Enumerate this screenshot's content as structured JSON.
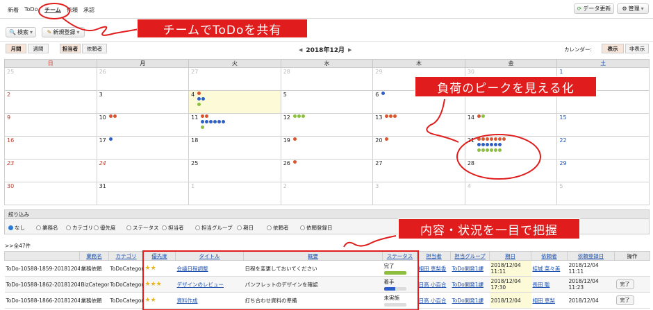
{
  "top_tabs": [
    "新着",
    "ToDo",
    "チーム",
    "依頼",
    "承認"
  ],
  "header_buttons": {
    "refresh": "データ更新",
    "admin": "管理"
  },
  "toolbar": {
    "search": "検索",
    "new": "新規登録"
  },
  "view_toggle": {
    "month": "月間",
    "week": "週間"
  },
  "person_toggle": {
    "assignee": "担当者",
    "requester": "依頼者"
  },
  "month_nav": {
    "prev": "◀",
    "label": "2018年12月",
    "next": "▶"
  },
  "calendar_toggle": {
    "label": "カレンダー:",
    "show": "表示",
    "hide": "非表示"
  },
  "weekdays": [
    "日",
    "月",
    "火",
    "水",
    "木",
    "金",
    "土"
  ],
  "colors": {
    "red": "#d9542e",
    "blue": "#2c5fc9",
    "green": "#8bbf3d",
    "callout": "#e01c1c",
    "accent_header": "#c0392b"
  },
  "weeks": [
    [
      {
        "d": "25",
        "dim": true,
        "dots": []
      },
      {
        "d": "26",
        "dim": true,
        "dots": []
      },
      {
        "d": "27",
        "dim": true,
        "dots": []
      },
      {
        "d": "28",
        "dim": true,
        "dots": []
      },
      {
        "d": "29",
        "dim": true,
        "dots": []
      },
      {
        "d": "30",
        "dim": true,
        "dots": []
      },
      {
        "d": "1",
        "dots": []
      }
    ],
    [
      {
        "d": "2",
        "dots": []
      },
      {
        "d": "3",
        "dots": []
      },
      {
        "d": "4",
        "today": true,
        "dots": [
          "red",
          "blue",
          "blue",
          "green"
        ]
      },
      {
        "d": "5",
        "dots": []
      },
      {
        "d": "6",
        "dots": [
          "blue"
        ]
      },
      {
        "d": "7",
        "dots": []
      },
      {
        "d": "8",
        "dots": []
      }
    ],
    [
      {
        "d": "9",
        "dots": []
      },
      {
        "d": "10",
        "dots": [
          "red",
          "red"
        ]
      },
      {
        "d": "11",
        "dots": [
          "red",
          "red",
          "blue",
          "blue",
          "blue",
          "blue",
          "blue",
          "blue",
          "green"
        ]
      },
      {
        "d": "12",
        "dots": [
          "green",
          "green",
          "green"
        ]
      },
      {
        "d": "13",
        "dots": [
          "red",
          "red",
          "red"
        ]
      },
      {
        "d": "14",
        "dots": [
          "red",
          "green"
        ]
      },
      {
        "d": "15",
        "dots": []
      }
    ],
    [
      {
        "d": "16",
        "dots": []
      },
      {
        "d": "17",
        "dots": [
          "blue"
        ]
      },
      {
        "d": "18",
        "dots": []
      },
      {
        "d": "19",
        "dots": [
          "red"
        ]
      },
      {
        "d": "20",
        "dots": [
          "red"
        ]
      },
      {
        "d": "21",
        "dots": [
          "red",
          "red",
          "red",
          "red",
          "red",
          "red",
          "red",
          "blue",
          "blue",
          "blue",
          "blue",
          "blue",
          "blue",
          "green",
          "green",
          "green",
          "green",
          "green",
          "green"
        ]
      },
      {
        "d": "22",
        "dots": []
      }
    ],
    [
      {
        "d": "23",
        "holiday": true,
        "dots": []
      },
      {
        "d": "24",
        "holiday": true,
        "dots": []
      },
      {
        "d": "25",
        "dots": []
      },
      {
        "d": "26",
        "dots": [
          "red"
        ]
      },
      {
        "d": "27",
        "dots": []
      },
      {
        "d": "28",
        "dots": []
      },
      {
        "d": "29",
        "dots": []
      }
    ],
    [
      {
        "d": "30",
        "dots": []
      },
      {
        "d": "31",
        "dots": []
      },
      {
        "d": "1",
        "dim": true,
        "dots": []
      },
      {
        "d": "2",
        "dim": true,
        "dots": []
      },
      {
        "d": "3",
        "dim": true,
        "dots": []
      },
      {
        "d": "4",
        "dim": true,
        "dots": []
      },
      {
        "d": "5",
        "dim": true,
        "dots": []
      }
    ]
  ],
  "filter": {
    "title": "絞り込み",
    "options": [
      "なし",
      "業務名",
      "カテゴリ",
      "優先度",
      "ステータス",
      "担当者",
      "担当グループ",
      "期日",
      "依頼者",
      "依頼登録日"
    ]
  },
  "total": ">>全47件",
  "list_headers": [
    "",
    "業務名",
    "カテゴリ",
    "優先度",
    "タイトル",
    "概要",
    "ステータス",
    "担当者",
    "担当グループ",
    "期日",
    "依頼者",
    "依頼登録日",
    "操作"
  ],
  "rows": [
    {
      "id": "ToDo-10588-1859-20181204",
      "biz": "業務依頼",
      "cat": "ToDoCategory",
      "stars": "★★",
      "title": "会議日程調整",
      "summary": "日程を変更しておいてください",
      "status": "完了",
      "progress": 1.0,
      "bar": "#8bbf3d",
      "assignee": "相田 恵梨香",
      "group": "ToDo開発1課",
      "due": "2018/12/04 11:11",
      "requester": "結城 菜々美",
      "reg": "2018/12/04 11:11",
      "op": ""
    },
    {
      "id": "ToDo-10588-1862-20181204",
      "biz": "BizCategory",
      "cat": "ToDoCategory",
      "stars": "★★★",
      "title": "デザインのレビュー",
      "summary": "パンフレットのデザインを確認",
      "status": "着手",
      "progress": 0.5,
      "bar": "#2c5fc9",
      "assignee": "日高 小百合",
      "group": "ToDo開発1課",
      "due": "2018/12/04 17:30",
      "requester": "長田 聡",
      "reg": "2018/12/04 11:23",
      "op": "完了"
    },
    {
      "id": "ToDo-10588-1866-20181204",
      "biz": "業務依頼",
      "cat": "ToDoCategory",
      "stars": "★★",
      "title": "資料作成",
      "summary": "打ち合わせ資料の準備",
      "status": "未実施",
      "progress": 0,
      "bar": "#2c5fc9",
      "assignee": "日高 小百合",
      "group": "ToDo開発1課",
      "due": "2018/12/04",
      "requester": "相田 恵梨",
      "reg": "2018/12/04",
      "op": "完了"
    }
  ],
  "callouts": {
    "team": "チームでToDoを共有",
    "peak": "負荷のピークを見える化",
    "detail": "内容・状況を一目で把握"
  }
}
